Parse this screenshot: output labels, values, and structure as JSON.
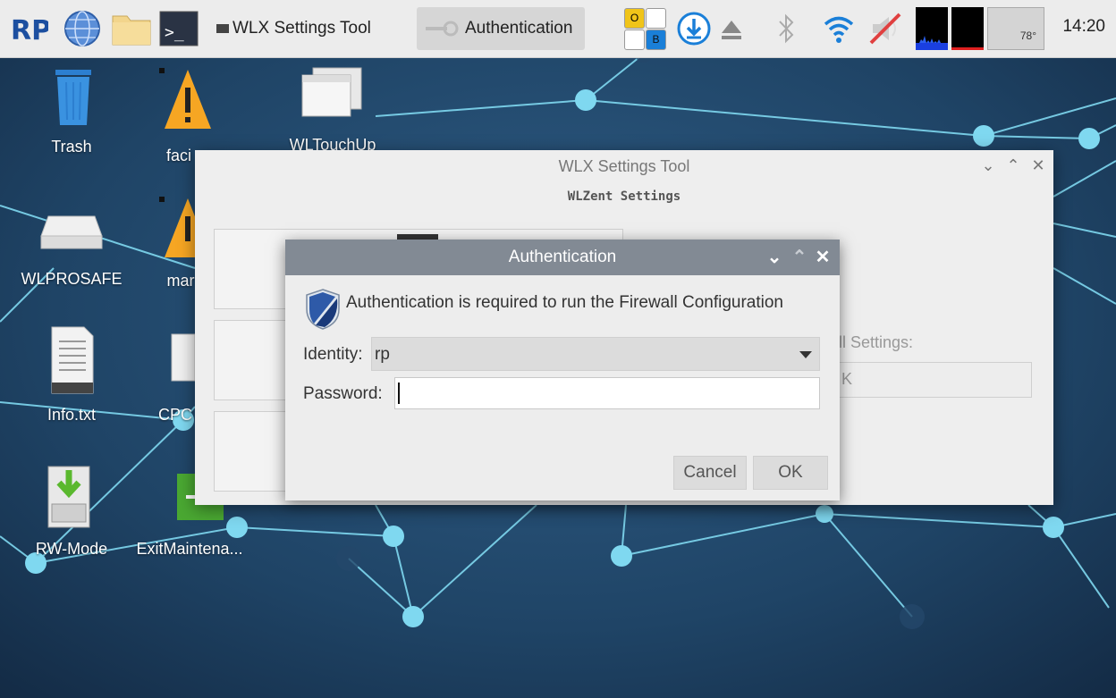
{
  "taskbar": {
    "logo_text": "RP",
    "tasks": [
      {
        "label": "WLX Settings Tool",
        "icon": "window-icon"
      },
      {
        "label": "Authentication",
        "icon": "key-icon"
      }
    ],
    "keyboard_indicators": [
      "O",
      "B"
    ],
    "temperature": "78°",
    "clock": "14:20"
  },
  "desktop": {
    "icons": [
      {
        "label": "Trash",
        "icon": "trash-icon"
      },
      {
        "label": "faci",
        "icon": "warning-icon"
      },
      {
        "label": "WLTouchUp",
        "icon": "windows-icon"
      },
      {
        "label": "WLPROSAFE",
        "icon": "drive-icon"
      },
      {
        "label": "mar",
        "icon": "warning-icon"
      },
      {
        "label": "Info.txt",
        "icon": "text-file-icon"
      },
      {
        "label": "CPC",
        "icon": "app-icon"
      },
      {
        "label": "RW-Mode",
        "icon": "install-icon"
      },
      {
        "label": "ExitMaintena...",
        "icon": "exit-icon"
      }
    ]
  },
  "settings_window": {
    "title": "WLX Settings Tool",
    "subtitle": "WLZent Settings",
    "partial_label": "ll Settings:",
    "partial_field_value": "K"
  },
  "auth_dialog": {
    "title": "Authentication",
    "message": "Authentication is required to run the Firewall Configuration",
    "identity_label": "Identity:",
    "identity_value": "rp",
    "password_label": "Password:",
    "password_value": "",
    "cancel_label": "Cancel",
    "ok_label": "OK"
  },
  "colors": {
    "desktop_bg": "#1e3c5c",
    "network_line": "#7fd8f0",
    "titlebar": "#828a94",
    "taskbar": "#ececec"
  }
}
